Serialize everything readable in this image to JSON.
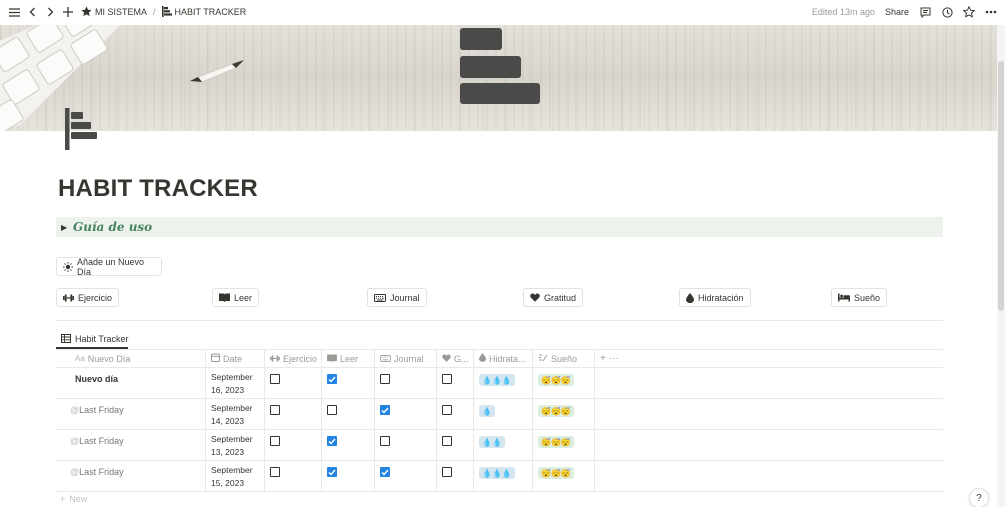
{
  "topbar": {
    "breadcrumb": [
      {
        "label": "MI SISTEMA",
        "icon": "star-icon"
      },
      {
        "label": "HABIT TRACKER",
        "icon": "bar-chart-icon"
      }
    ],
    "separator": "/",
    "edited": "Edited 13m ago",
    "share": "Share"
  },
  "page": {
    "title": "HABIT TRACKER",
    "toggle": {
      "label": "Guía de uso",
      "color": "#448361",
      "background": "#edf3ec"
    },
    "add_day_button": "Añade un Nuevo Día",
    "buttons": [
      {
        "label": "Ejercicio",
        "icon": "dumbbell-icon"
      },
      {
        "label": "Leer",
        "icon": "book-icon"
      },
      {
        "label": "Journal",
        "icon": "keyboard-icon"
      },
      {
        "label": "Gratitud",
        "icon": "heart-icon"
      },
      {
        "label": "Hidratación",
        "icon": "droplet-icon"
      },
      {
        "label": "Sueño",
        "icon": "bed-icon"
      }
    ]
  },
  "database": {
    "view_tab": "Habit Tracker",
    "columns": [
      {
        "label": "Nuevo Día",
        "prefix": "Aa",
        "icon": "title-icon"
      },
      {
        "label": "Date",
        "icon": "calendar-icon"
      },
      {
        "label": "Ejercicio",
        "icon": "dumbbell-icon"
      },
      {
        "label": "Leer",
        "icon": "book-icon"
      },
      {
        "label": "Journal",
        "icon": "keyboard-icon"
      },
      {
        "label": "G...",
        "icon": "heart-icon"
      },
      {
        "label": "Hidrata...",
        "icon": "droplet-icon"
      },
      {
        "label": "Sueño",
        "icon": "formula-icon"
      }
    ],
    "rows": [
      {
        "name": "Nuevo día",
        "mention": false,
        "date_line1": "September",
        "date_line2": "16, 2023",
        "ejercicio": false,
        "leer": true,
        "journal": false,
        "gratitud": false,
        "water": "💧💧💧",
        "sleep": "😴😴😴"
      },
      {
        "name": "Last Friday",
        "mention": true,
        "date_line1": "September",
        "date_line2": "14, 2023",
        "ejercicio": false,
        "leer": false,
        "journal": true,
        "gratitud": false,
        "water": "💧",
        "sleep": "😴😴😴"
      },
      {
        "name": "Last Friday",
        "mention": true,
        "date_line1": "September",
        "date_line2": "13, 2023",
        "ejercicio": false,
        "leer": true,
        "journal": false,
        "gratitud": false,
        "water": "💧💧",
        "sleep": "😴😴😴"
      },
      {
        "name": "Last Friday",
        "mention": true,
        "date_line1": "September",
        "date_line2": "15, 2023",
        "ejercicio": false,
        "leer": true,
        "journal": true,
        "gratitud": false,
        "water": "💧💧💧",
        "sleep": "😴😴😴"
      }
    ],
    "mention_prefix": "@",
    "add_column": "+",
    "more": "···",
    "new_row": "New"
  },
  "help": "?",
  "colors": {
    "check_on": "#2383e2",
    "text": "#37352f",
    "muted": "#9b9a97"
  }
}
